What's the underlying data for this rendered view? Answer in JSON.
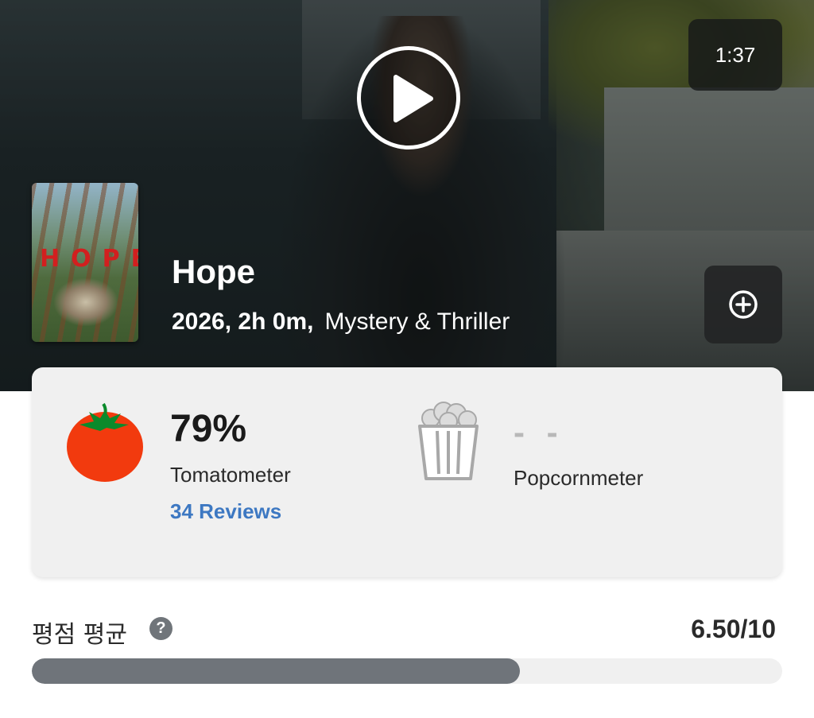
{
  "video": {
    "duration": "1:37"
  },
  "movie": {
    "title": "Hope",
    "year_runtime": "2026, 2h 0m,",
    "genre": "Mystery & Thriller",
    "poster_text": "HOPE"
  },
  "scores": {
    "tomatometer": {
      "value": "79%",
      "label": "Tomatometer",
      "reviews": "34 Reviews"
    },
    "popcornmeter": {
      "value": "- -",
      "label": "Popcornmeter"
    }
  },
  "rating": {
    "label": "평점 평균",
    "value": "6.50/10",
    "fraction": 0.65,
    "help_symbol": "?"
  },
  "colors": {
    "tomato": "#f23a0e",
    "link": "#3d78c2",
    "bar_fill": "#6f747a",
    "bar_track": "#f0f0f0",
    "card_bg": "#f0f0f0"
  },
  "icons": {
    "play": "play-icon",
    "add": "add-circle-icon",
    "tomato": "tomato-icon",
    "popcorn": "popcorn-icon",
    "help": "help-icon"
  }
}
